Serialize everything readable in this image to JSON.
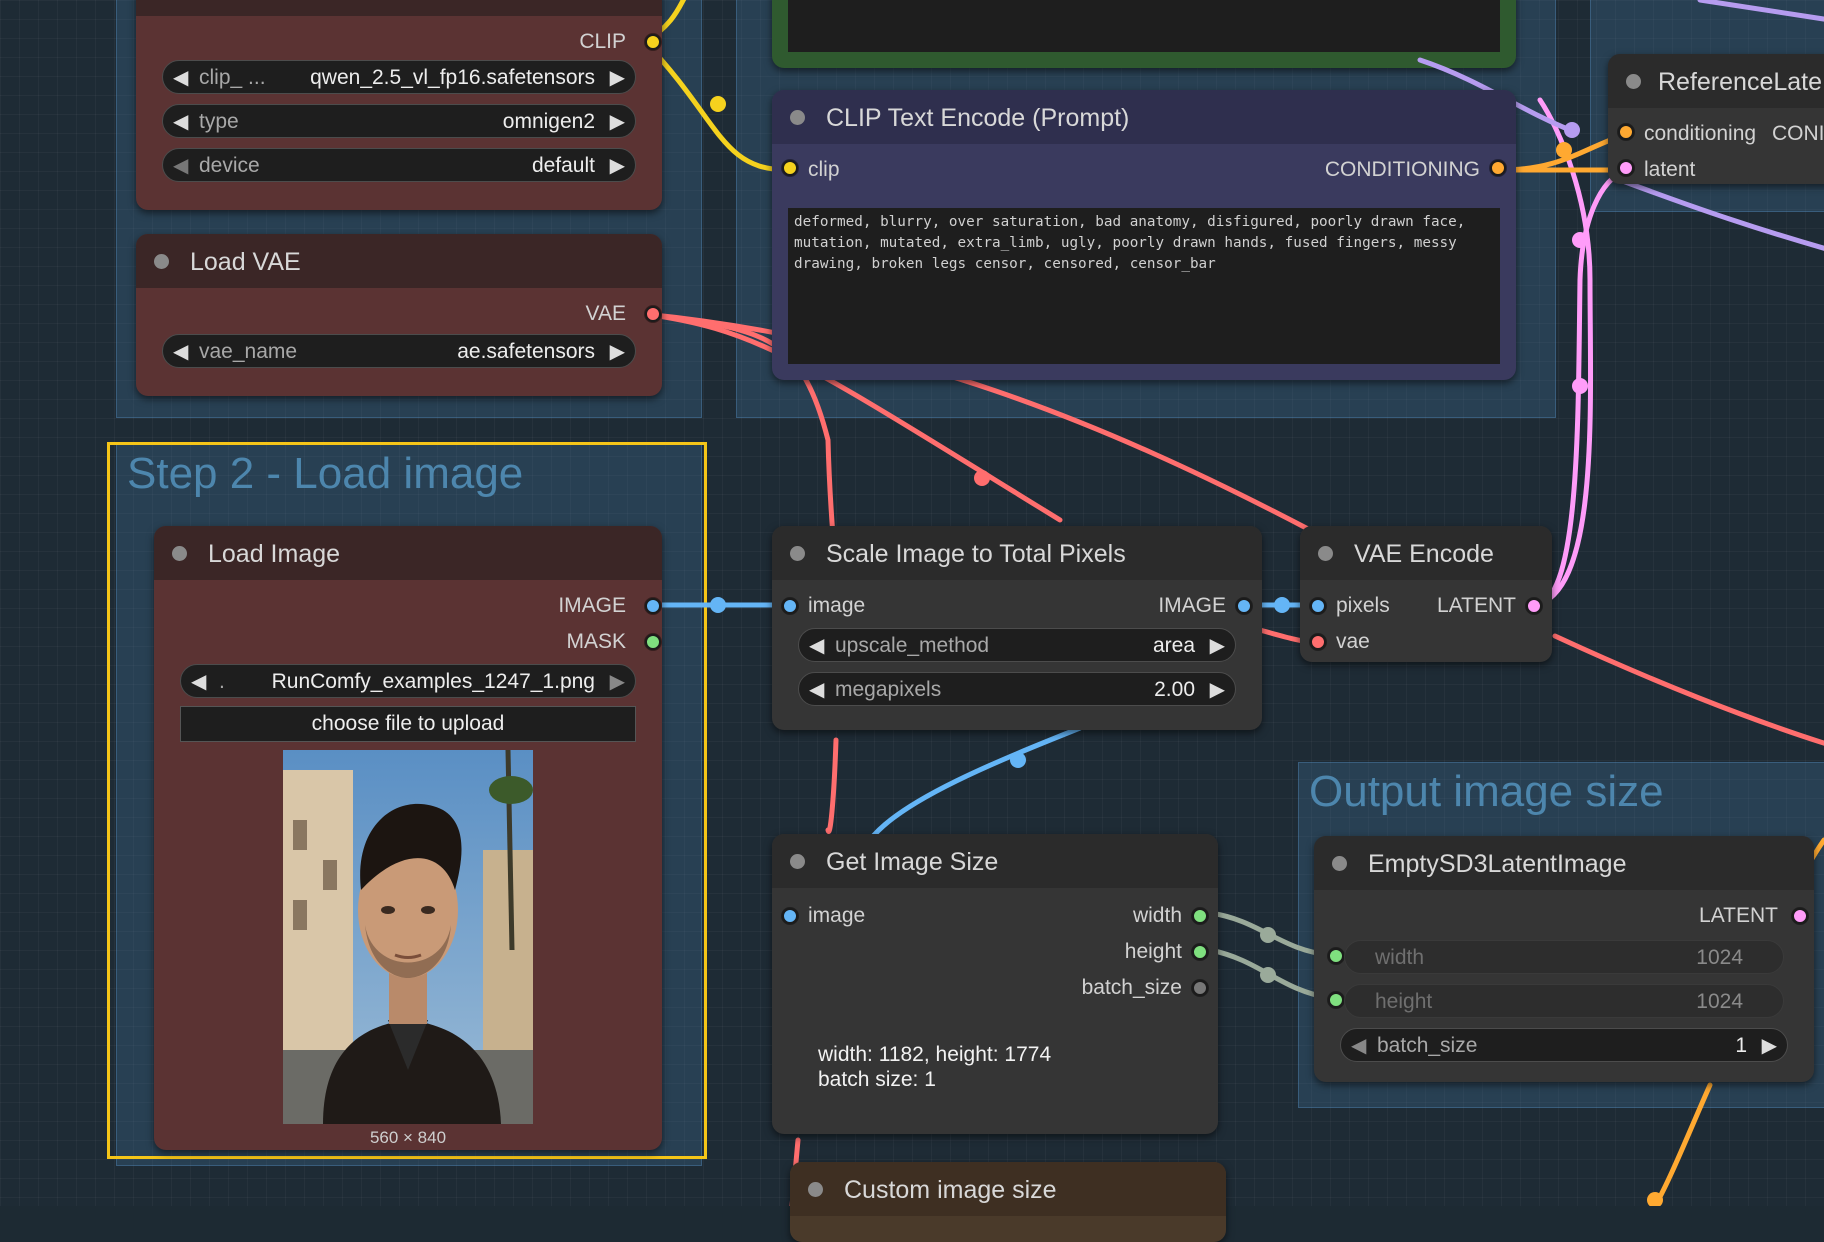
{
  "groups": {
    "step2": {
      "title": "Step 2 - Load image"
    },
    "output_size": {
      "title": "Output image size"
    }
  },
  "nodes": {
    "clip_loader": {
      "outputs": [
        "CLIP"
      ],
      "widgets": [
        {
          "label": "clip_ ...",
          "value": "qwen_2.5_vl_fp16.safetensors"
        },
        {
          "label": "type",
          "value": "omnigen2"
        },
        {
          "label": "device",
          "value": "default"
        }
      ]
    },
    "load_vae": {
      "title": "Load VAE",
      "outputs": [
        "VAE"
      ],
      "widgets": [
        {
          "label": "vae_name",
          "value": "ae.safetensors"
        }
      ]
    },
    "clip_text_encode": {
      "title": "CLIP Text Encode (Prompt)",
      "inputs": [
        "clip"
      ],
      "outputs": [
        "CONDITIONING"
      ],
      "text": "deformed, blurry, over saturation, bad anatomy, disfigured, poorly drawn face, mutation, mutated, extra_limb, ugly, poorly drawn hands, fused fingers, messy drawing, broken legs censor, censored, censor_bar"
    },
    "reference_latent": {
      "title": "ReferenceLate",
      "inputs": [
        "conditioning",
        "latent"
      ],
      "outputs": [
        "CONI"
      ]
    },
    "load_image": {
      "title": "Load Image",
      "outputs": [
        "IMAGE",
        "MASK"
      ],
      "widgets": [
        {
          "label": ".",
          "value": "RunComfy_examples_1247_1.png"
        }
      ],
      "upload_label": "choose file to upload",
      "image_dims": "560 × 840"
    },
    "scale_image": {
      "title": "Scale Image to Total Pixels",
      "inputs": [
        "image"
      ],
      "outputs": [
        "IMAGE"
      ],
      "widgets": [
        {
          "label": "upscale_method",
          "value": "area"
        },
        {
          "label": "megapixels",
          "value": "2.00"
        }
      ]
    },
    "vae_encode": {
      "title": "VAE Encode",
      "inputs": [
        "pixels",
        "vae"
      ],
      "outputs": [
        "LATENT"
      ]
    },
    "get_image_size": {
      "title": "Get Image Size",
      "inputs": [
        "image"
      ],
      "outputs": [
        "width",
        "height",
        "batch_size"
      ],
      "info_line1": "width: 1182, height: 1774",
      "info_line2": "batch size: 1"
    },
    "empty_latent": {
      "title": "EmptySD3LatentImage",
      "outputs": [
        "LATENT"
      ],
      "widgets": [
        {
          "label": "width",
          "value": "1024"
        },
        {
          "label": "height",
          "value": "1024"
        },
        {
          "label": "batch_size",
          "value": "1"
        }
      ]
    },
    "custom_image_size": {
      "title": "Custom image size"
    }
  },
  "colors": {
    "clip": "#f5d21e",
    "vae": "#ff6e6e",
    "image": "#64b5f6",
    "latent": "#ff9cf9",
    "conditioning": "#ffa931",
    "int": "#7fe07f",
    "selection": "#f5c518"
  }
}
